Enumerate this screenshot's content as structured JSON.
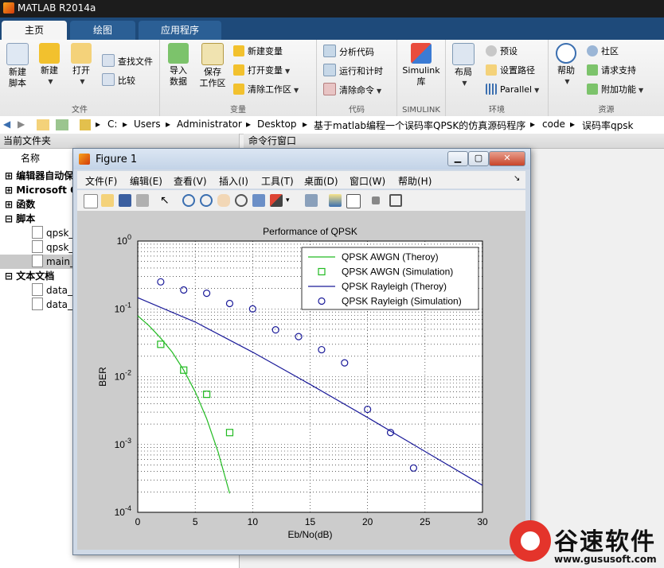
{
  "app": {
    "title": "MATLAB R2014a"
  },
  "tabs": [
    {
      "label": "主页"
    },
    {
      "label": "绘图"
    },
    {
      "label": "应用程序"
    }
  ],
  "ribbon": {
    "file": {
      "label": "文件",
      "new_script": "新建\n脚本",
      "new": "新建",
      "open": "打开",
      "find_files": "查找文件",
      "compare": "比较"
    },
    "variable": {
      "label": "变量",
      "import_data": "导入\n数据",
      "save_ws": "保存\n工作区",
      "new_var": "新建变量",
      "open_var": "打开变量",
      "clear_ws": "清除工作区"
    },
    "code": {
      "label": "代码",
      "analyze": "分析代码",
      "run_time": "运行和计时",
      "clear_cmd": "清除命令"
    },
    "simulink": {
      "label": "SIMULINK",
      "lib": "Simulink\n库"
    },
    "env": {
      "label": "环境",
      "layout": "布局",
      "prefs": "预设",
      "set_path": "设置路径",
      "parallel": "Parallel"
    },
    "resources": {
      "label": "资源",
      "help": "帮助",
      "community": "社区",
      "support": "请求支持",
      "addons": "附加功能"
    }
  },
  "address": {
    "parts": [
      "C:",
      "Users",
      "Administrator",
      "Desktop",
      "基于matlab编程一个误码率QPSK的仿真源码程序",
      "code",
      "误码率qpsk"
    ]
  },
  "left_panel": {
    "header": "当前文件夹",
    "col_name": "名称",
    "items": [
      {
        "label": "编辑器自动保"
      },
      {
        "label": "Microsoft O"
      },
      {
        "label": "函数"
      },
      {
        "label": "脚本"
      },
      {
        "label": "qpsk_"
      },
      {
        "label": "qpsk_"
      },
      {
        "label": "main_"
      },
      {
        "label": "文本文档"
      },
      {
        "label": "data_r"
      },
      {
        "label": "data_a"
      }
    ]
  },
  "command_window": {
    "header": "命令行窗口"
  },
  "figure": {
    "title": "Figure 1",
    "menu": [
      "文件(F)",
      "编辑(E)",
      "查看(V)",
      "插入(I)",
      "工具(T)",
      "桌面(D)",
      "窗口(W)",
      "帮助(H)"
    ]
  },
  "chart_data": {
    "type": "line",
    "title": "Performance of QPSK",
    "xlabel": "Eb/No(dB)",
    "ylabel": "BER",
    "xlim": [
      0,
      30
    ],
    "ylim": [
      0.0001,
      1
    ],
    "yscale": "log",
    "grid": true,
    "legend_position": "top-right",
    "x_ticks": [
      "0",
      "5",
      "10",
      "15",
      "20",
      "25",
      "30"
    ],
    "y_ticks": [
      "10^0",
      "10^-1",
      "10^-2",
      "10^-3",
      "10^-4"
    ],
    "series": [
      {
        "name": "QPSK AWGN (Theroy)",
        "style": "line",
        "color": "#22bb22",
        "x": [
          0,
          1,
          2,
          3,
          4,
          5,
          6,
          7,
          8
        ],
        "y": [
          0.079,
          0.056,
          0.037,
          0.023,
          0.0125,
          0.006,
          0.0024,
          0.00077,
          0.00019
        ]
      },
      {
        "name": "QPSK AWGN (Simulation)",
        "style": "square",
        "color": "#22bb22",
        "x": [
          2,
          4,
          6,
          8
        ],
        "y": [
          0.03,
          0.0125,
          0.0055,
          0.0015
        ]
      },
      {
        "name": "QPSK Rayleigh (Theroy)",
        "style": "line",
        "color": "#1a1a99",
        "x": [
          0,
          5,
          10,
          15,
          20,
          25,
          30
        ],
        "y": [
          0.146,
          0.064,
          0.023,
          0.0077,
          0.0025,
          0.00079,
          0.00025
        ]
      },
      {
        "name": "QPSK Rayleigh (Simulation)",
        "style": "circle",
        "color": "#1a1a99",
        "x": [
          2,
          4,
          6,
          8,
          10,
          12,
          14,
          16,
          18,
          20,
          22,
          24
        ],
        "y": [
          0.25,
          0.19,
          0.17,
          0.12,
          0.1,
          0.049,
          0.039,
          0.025,
          0.016,
          0.0033,
          0.0015,
          0.00045
        ]
      }
    ]
  },
  "watermark": {
    "cn": "谷速软件",
    "url": "www.gususoft.com"
  },
  "colors": {
    "tabbar": "#1e4a7a",
    "awgn": "#22bb22",
    "rayleigh": "#1a1a99"
  }
}
